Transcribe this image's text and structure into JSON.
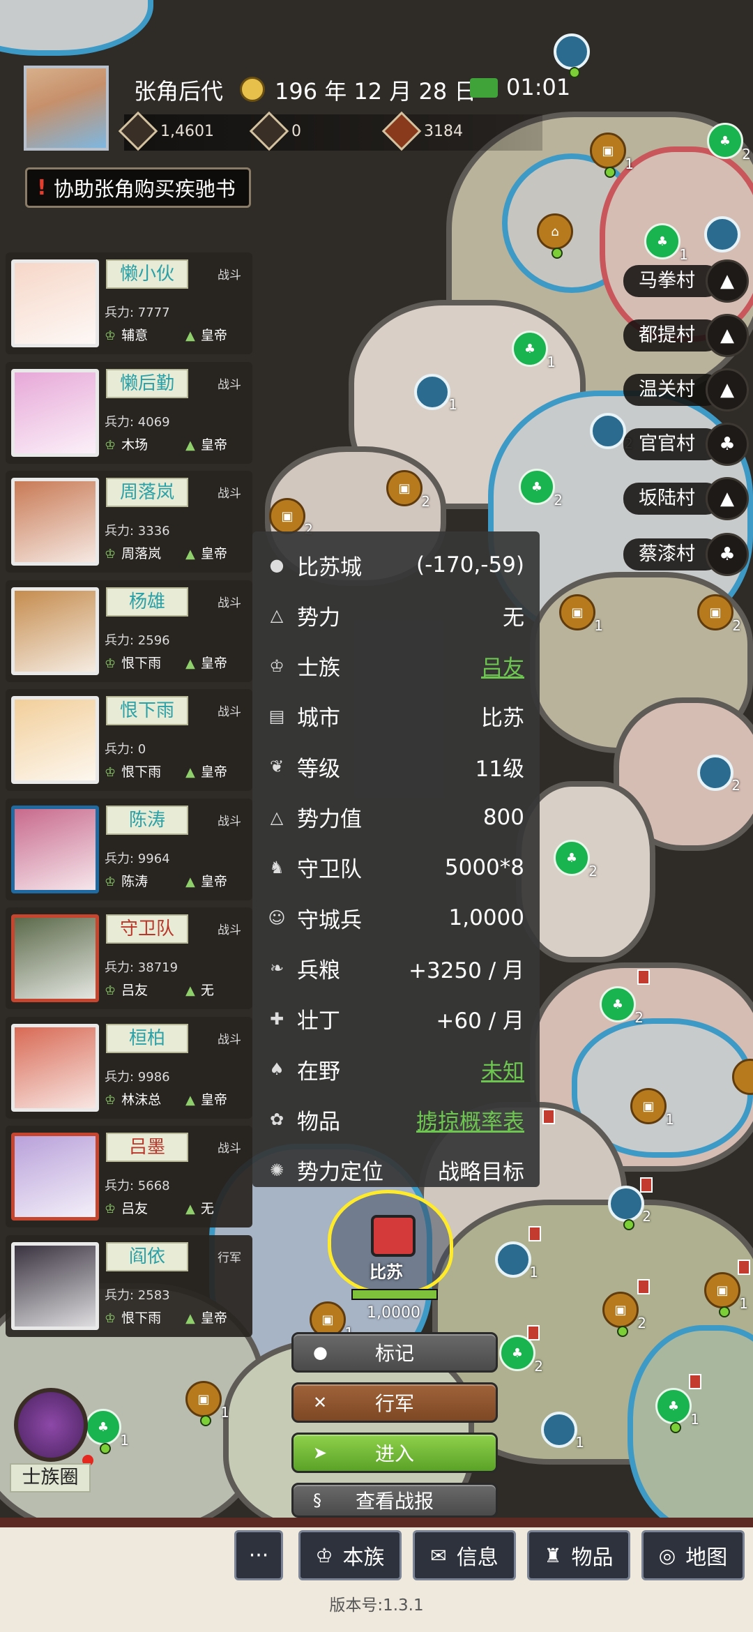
{
  "header": {
    "player_name": "张角后代",
    "date": "196 年 12 月 28 日",
    "time": "01:01",
    "resources": [
      {
        "icon": "silver-icon",
        "value": "1,4601"
      },
      {
        "icon": "food-plate-icon",
        "value": "0"
      },
      {
        "icon": "gift-bag-icon",
        "value": "3184"
      }
    ]
  },
  "quest": {
    "mark": "!",
    "text": "协助张角购买疾驰书"
  },
  "heroes": [
    {
      "name": "懒小伙",
      "status": "战斗",
      "troops": "兵力: 7777",
      "clan": "辅意",
      "emperor": "皇帝",
      "frame": "white",
      "name_color": "teal"
    },
    {
      "name": "懒后勤",
      "status": "战斗",
      "troops": "兵力: 4069",
      "clan": "木场",
      "emperor": "皇帝",
      "frame": "white",
      "name_color": "teal"
    },
    {
      "name": "周落岚",
      "status": "战斗",
      "troops": "兵力: 3336",
      "clan": "周落岚",
      "emperor": "皇帝",
      "frame": "white",
      "name_color": "teal"
    },
    {
      "name": "杨雄",
      "status": "战斗",
      "troops": "兵力: 2596",
      "clan": "恨下雨",
      "emperor": "皇帝",
      "frame": "white",
      "name_color": "teal"
    },
    {
      "name": "恨下雨",
      "status": "战斗",
      "troops": "兵力: 0",
      "clan": "恨下雨",
      "emperor": "皇帝",
      "frame": "white",
      "name_color": "teal"
    },
    {
      "name": "陈涛",
      "status": "战斗",
      "troops": "兵力: 9964",
      "clan": "陈涛",
      "emperor": "皇帝",
      "frame": "blue",
      "name_color": "teal"
    },
    {
      "name": "守卫队",
      "status": "战斗",
      "troops": "兵力: 38719",
      "clan": "吕友",
      "emperor": "无",
      "frame": "red",
      "name_color": "red"
    },
    {
      "name": "桓柏",
      "status": "战斗",
      "troops": "兵力: 9986",
      "clan": "林沫总",
      "emperor": "皇帝",
      "frame": "white",
      "name_color": "teal"
    },
    {
      "name": "吕墨",
      "status": "战斗",
      "troops": "兵力: 5668",
      "clan": "吕友",
      "emperor": "无",
      "frame": "red",
      "name_color": "red"
    },
    {
      "name": "阎依",
      "status": "行军",
      "troops": "兵力: 2583",
      "clan": "恨下雨",
      "emperor": "皇帝",
      "frame": "white",
      "name_color": "teal"
    }
  ],
  "info": [
    {
      "icon": "pin-icon",
      "label": "比苏城",
      "value": "(-170,-59)",
      "link": false
    },
    {
      "icon": "mountain-icon",
      "label": "势力",
      "value": "无",
      "link": false
    },
    {
      "icon": "clan-icon",
      "label": "士族",
      "value": "吕友",
      "link": true
    },
    {
      "icon": "city-icon",
      "label": "城市",
      "value": "比苏",
      "link": false
    },
    {
      "icon": "wing-icon",
      "label": "等级",
      "value": "11级",
      "link": false
    },
    {
      "icon": "mountain-icon",
      "label": "势力值",
      "value": "800",
      "link": false
    },
    {
      "icon": "guard-icon",
      "label": "守卫队",
      "value": "5000*8",
      "link": false
    },
    {
      "icon": "soldier-icon",
      "label": "守城兵",
      "value": "1,0000",
      "link": false
    },
    {
      "icon": "grain-icon",
      "label": "兵粮",
      "value": "+3250 / 月",
      "link": false
    },
    {
      "icon": "strength-icon",
      "label": "壮丁",
      "value": "+60 / 月",
      "link": false
    },
    {
      "icon": "boot-icon",
      "label": "在野",
      "value": "未知",
      "link": true
    },
    {
      "icon": "item-icon",
      "label": "物品",
      "value": "掳掠概率表",
      "link": true
    },
    {
      "icon": "target-icon",
      "label": "势力定位",
      "value": "战略目标",
      "link": false
    }
  ],
  "villages": [
    {
      "name": "马拳村",
      "icon": "mountain-icon"
    },
    {
      "name": "都提村",
      "icon": "mountain-icon"
    },
    {
      "name": "温关村",
      "icon": "mountain-icon"
    },
    {
      "name": "官官村",
      "icon": "forest-icon"
    },
    {
      "name": "坂陆村",
      "icon": "mountain-icon"
    },
    {
      "name": "蔡漆村",
      "icon": "forest-icon"
    }
  ],
  "selected_city": {
    "name": "比苏",
    "defense": "1,0000",
    "hp_fraction": 1.0,
    "outline_color": "#ffeb2a"
  },
  "actions": {
    "mark": "标记",
    "march": "行军",
    "enter": "进入",
    "report": "查看战报"
  },
  "clan_circle": {
    "label": "士族圈"
  },
  "nav": {
    "more": "···",
    "clan": "本族",
    "info": "信息",
    "items": "物品",
    "map": "地图"
  },
  "version": "版本号:1.3.1",
  "colors": {
    "link_green": "#6cc64f",
    "selection_yellow": "#ffeb2a",
    "hero_name_teal": "#2aa0a7",
    "hero_name_red": "#b9372a"
  }
}
